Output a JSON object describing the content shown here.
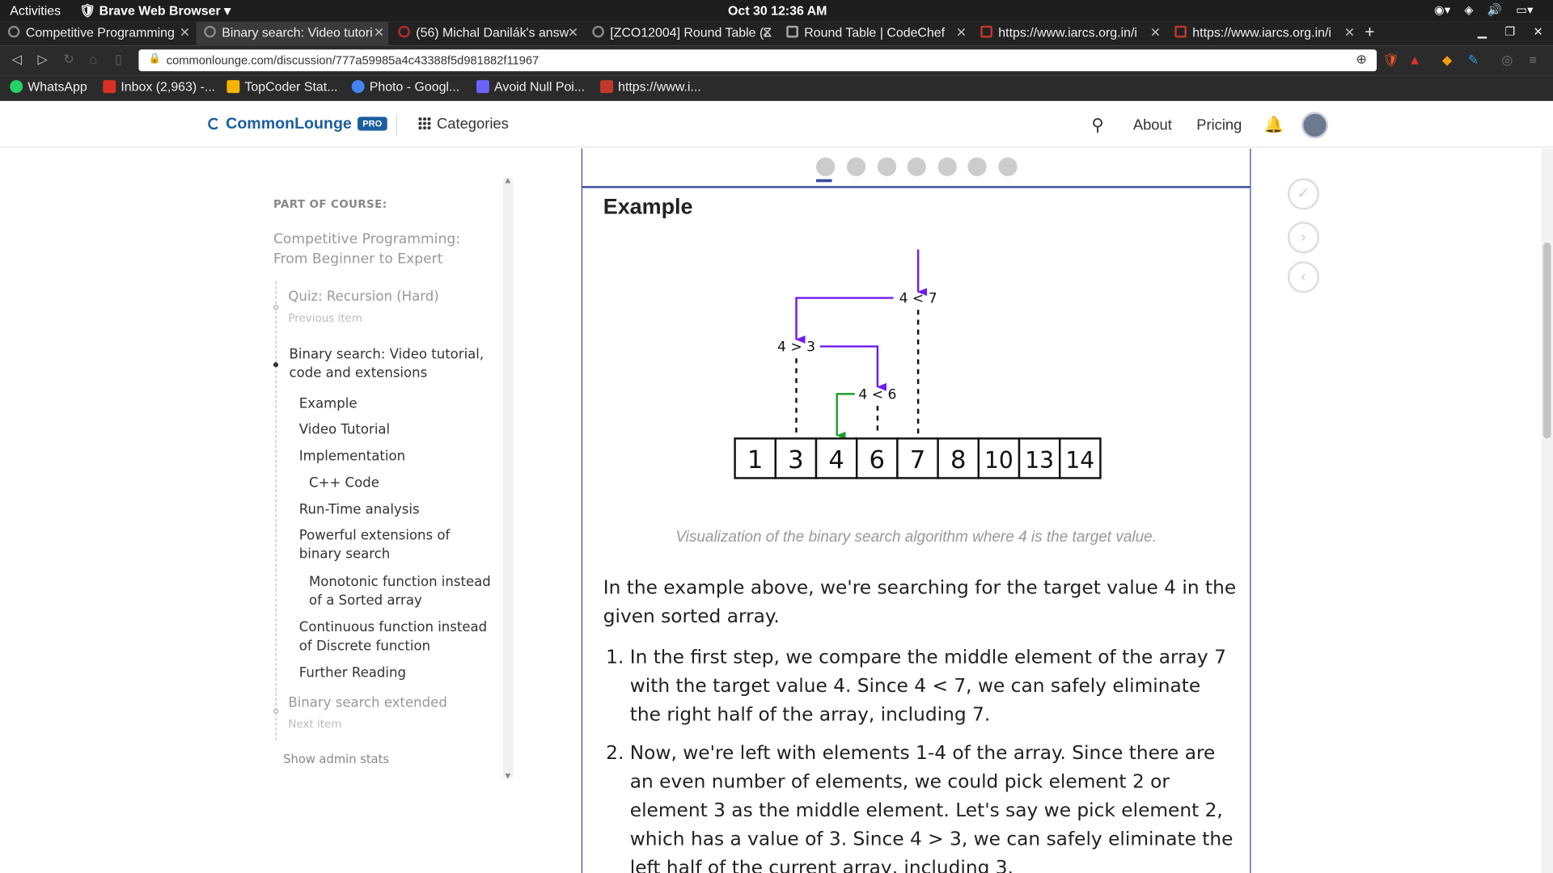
{
  "system": {
    "activities": "Activities",
    "browser_name": "Brave Web Browser",
    "clock": "Oct 30  12:36 AM"
  },
  "tabs": [
    {
      "label": "Competitive Programming"
    },
    {
      "label": "Binary search: Video tutori"
    },
    {
      "label": "(56) Michal Danilák's answ"
    },
    {
      "label": "[ZCO12004] Round Table (Z"
    },
    {
      "label": "Round Table | CodeChef"
    },
    {
      "label": "https://www.iarcs.org.in/i"
    },
    {
      "label": "https://www.iarcs.org.in/i"
    }
  ],
  "address": {
    "url": "commonlounge.com/discussion/777a59985a4c43388f5d981882f11967"
  },
  "bookmarks": [
    {
      "label": "WhatsApp",
      "color": "#25d366"
    },
    {
      "label": "Inbox (2,963) -...",
      "color": "#d93025"
    },
    {
      "label": "TopCoder Stat...",
      "color": "#f4b400"
    },
    {
      "label": "Photo - Googl...",
      "color": "#4285f4"
    },
    {
      "label": "Avoid Null Poi...",
      "color": "#6c63ff"
    },
    {
      "label": "https://www.i...",
      "color": "#c0392b"
    }
  ],
  "site": {
    "logo": "CommonLounge",
    "pro": "PRO",
    "categories": "Categories",
    "about": "About",
    "pricing": "Pricing"
  },
  "sidebar": {
    "part_of_course": "PART OF COURSE:",
    "course_title": "Competitive Programming: From Beginner to Expert",
    "prev_title": "Quiz: Recursion (Hard)",
    "prev_label": "Previous item",
    "current_title": "Binary search: Video tutorial, code and extensions",
    "sections": [
      {
        "label": "Example",
        "level": 1
      },
      {
        "label": "Video Tutorial",
        "level": 1
      },
      {
        "label": "Implementation",
        "level": 1
      },
      {
        "label": "C++ Code",
        "level": 2
      },
      {
        "label": "Run-Time analysis",
        "level": 1
      },
      {
        "label": "Powerful extensions of binary search",
        "level": 1
      },
      {
        "label": "Monotonic function instead of a Sorted array",
        "level": 2
      },
      {
        "label": "Continuous function instead of Discrete function",
        "level": 1
      },
      {
        "label": "Further Reading",
        "level": 1
      }
    ],
    "next_title": "Binary search extended",
    "next_label": "Next item",
    "admin": "Show admin stats"
  },
  "content": {
    "step_count": 7,
    "active_step": 1,
    "heading": "Example",
    "figure": {
      "array": [
        "1",
        "3",
        "4",
        "6",
        "7",
        "8",
        "10",
        "13",
        "14"
      ],
      "comparisons": [
        "4 < 7",
        "4 > 3",
        "4 < 6"
      ]
    },
    "caption": "Visualization of the binary search algorithm where 4 is the target value.",
    "intro": "In the example above, we're searching for the target value 4 in the given sorted array.",
    "steps": [
      "In the first step, we compare the middle element of the array 7 with the target value 4. Since 4 < 7, we can safely eliminate the right half of the array, including 7.",
      "Now, we're left with elements 1-4 of the array. Since there are an even number of elements, we could pick element 2 or element 3 as the middle element. Let's say we pick element 2, which has a value of 3. Since 4 > 3, we can safely eliminate the left half of the current array, including 3."
    ]
  },
  "colors": {
    "accent": "#3b4ba0",
    "purple": "#6f1cf2",
    "green": "#1f9e2e"
  }
}
